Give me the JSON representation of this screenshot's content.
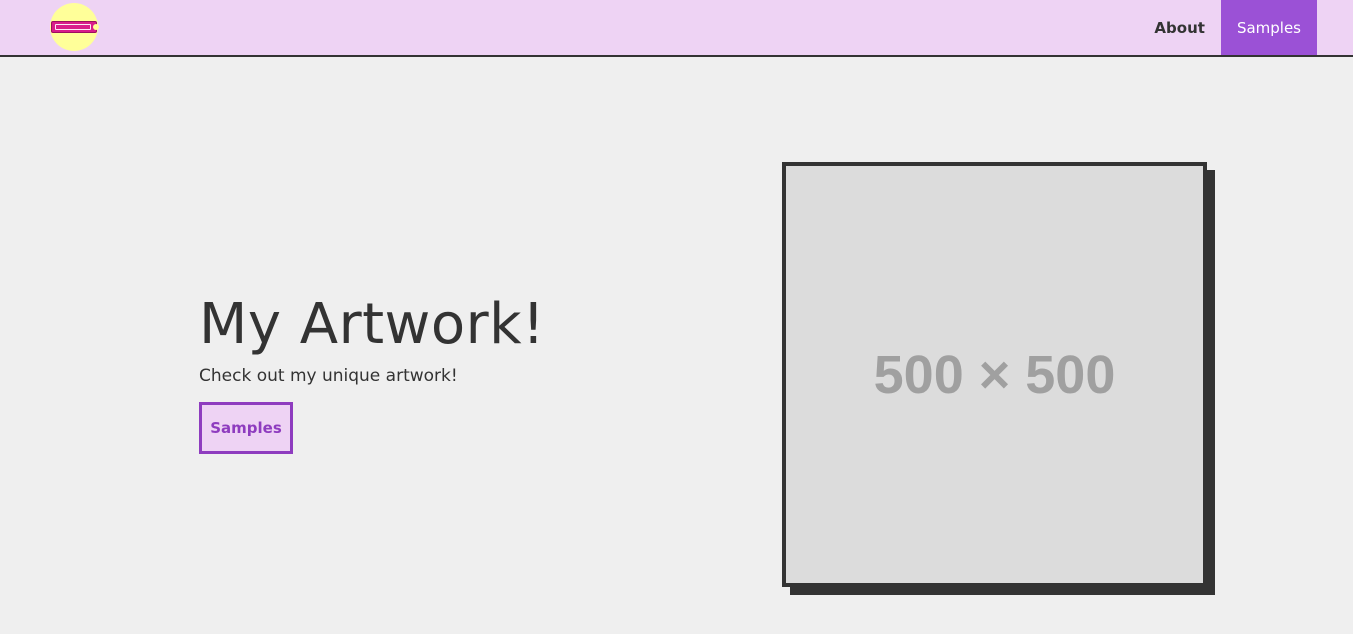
{
  "nav": {
    "logo_icon": "brand-logo",
    "links": [
      {
        "label": "About"
      },
      {
        "label": "Samples"
      }
    ]
  },
  "hero": {
    "title": "My Artwork!",
    "subtitle": "Check out my unique artwork!",
    "button_label": "Samples"
  },
  "image": {
    "placeholder_text": "500 × 500"
  },
  "colors": {
    "navbar_bg": "#eed3f4",
    "accent": "#9b51d6",
    "button_border": "#8e3cbf",
    "page_bg": "#efefef",
    "logo_bg": "#ffff99"
  }
}
